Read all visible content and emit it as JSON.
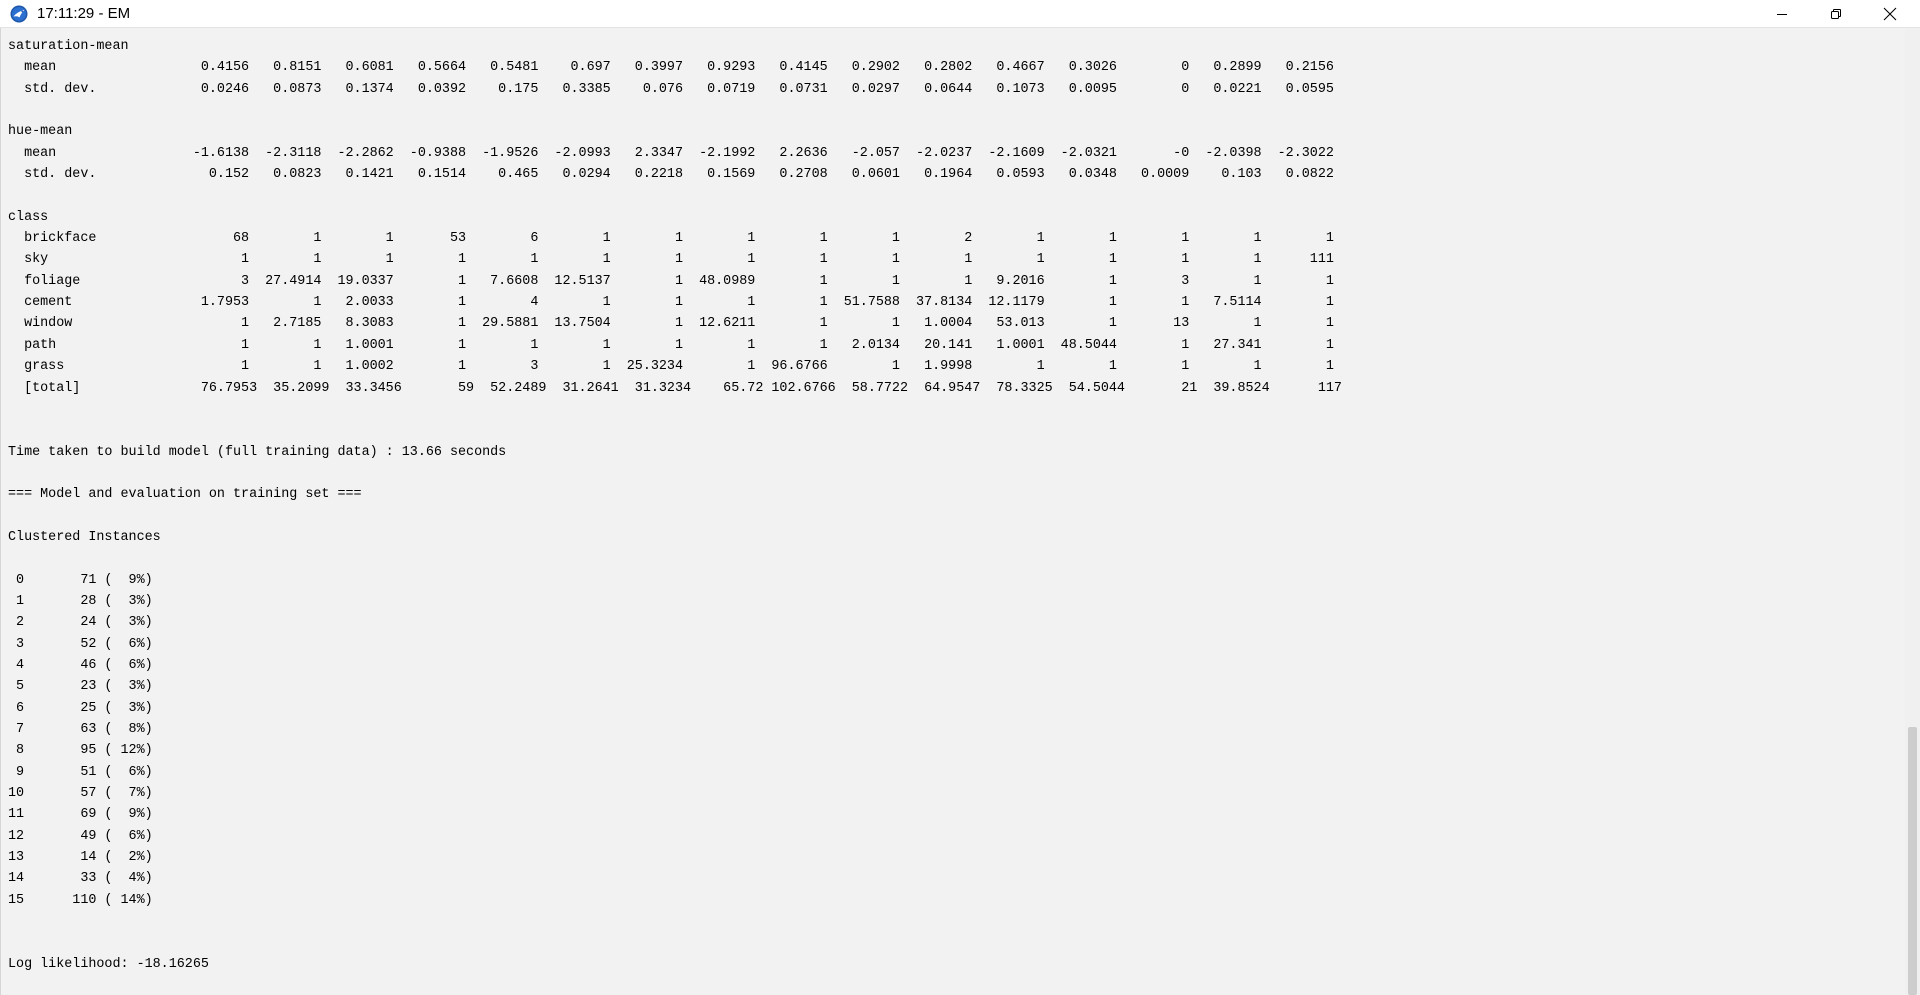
{
  "window": {
    "title": "17:11:29 - EM",
    "icons": {
      "app": "weka-bird-icon",
      "minimize": "minimize-icon",
      "maximize": "restore-icon",
      "close": "close-icon"
    }
  },
  "output": {
    "lines": [
      "saturation-mean",
      "  mean                  0.4156   0.8151   0.6081   0.5664   0.5481    0.697   0.3997   0.9293   0.4145   0.2902   0.2802   0.4667   0.3026        0   0.2899   0.2156",
      "  std. dev.             0.0246   0.0873   0.1374   0.0392    0.175   0.3385    0.076   0.0719   0.0731   0.0297   0.0644   0.1073   0.0095        0   0.0221   0.0595",
      "",
      "hue-mean",
      "  mean                 -1.6138  -2.3118  -2.2862  -0.9388  -1.9526  -2.0993   2.3347  -2.1992   2.2636   -2.057  -2.0237  -2.1609  -2.0321       -0  -2.0398  -2.3022",
      "  std. dev.              0.152   0.0823   0.1421   0.1514    0.465   0.0294   0.2218   0.1569   0.2708   0.0601   0.1964   0.0593   0.0348   0.0009    0.103   0.0822",
      "",
      "class",
      "  brickface                 68        1        1       53        6        1        1        1        1        1        2        1        1        1        1        1",
      "  sky                        1        1        1        1        1        1        1        1        1        1        1        1        1        1        1      111",
      "  foliage                    3  27.4914  19.0337        1   7.6608  12.5137        1  48.0989        1        1        1   9.2016        1        3        1        1",
      "  cement                1.7953        1   2.0033        1        4        1        1        1        1  51.7588  37.8134  12.1179        1        1   7.5114        1",
      "  window                     1   2.7185   8.3083        1  29.5881  13.7504        1  12.6211        1        1   1.0004   53.013        1       13        1        1",
      "  path                       1        1   1.0001        1        1        1        1        1        1   2.0134   20.141   1.0001  48.5044        1   27.341        1",
      "  grass                      1        1   1.0002        1        3        1  25.3234        1  96.6766        1   1.9998        1        1        1        1        1",
      "  [total]               76.7953  35.2099  33.3456       59  52.2489  31.2641  31.3234    65.72 102.6766  58.7722  64.9547  78.3325  54.5044       21  39.8524      117",
      "",
      "",
      "Time taken to build model (full training data) : 13.66 seconds",
      "",
      "=== Model and evaluation on training set ===",
      "",
      "Clustered Instances",
      "",
      " 0       71 (  9%)",
      " 1       28 (  3%)",
      " 2       24 (  3%)",
      " 3       52 (  6%)",
      " 4       46 (  6%)",
      " 5       23 (  3%)",
      " 6       25 (  3%)",
      " 7       63 (  8%)",
      " 8       95 ( 12%)",
      " 9       51 (  6%)",
      "10       57 (  7%)",
      "11       69 (  9%)",
      "12       49 (  6%)",
      "13       14 (  2%)",
      "14       33 (  4%)",
      "15      110 ( 14%)",
      "",
      "",
      "Log likelihood: -18.16265"
    ]
  }
}
